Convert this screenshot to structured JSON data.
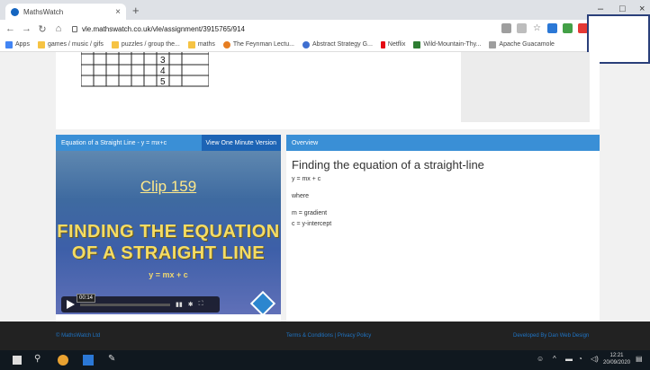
{
  "browser": {
    "tab_title": "MathsWatch",
    "tab_close": "×",
    "new_tab": "+",
    "url": "vle.mathswatch.co.uk/vle/assignment/3915765/914",
    "bookmarks": [
      "Apps",
      "games / music / gifs",
      "puzzles / group the...",
      "maths",
      "The Feynman Lectu...",
      "Abstract Strategy G...",
      "Netflix",
      "Wild-Mountain-Thy...",
      "Apache Guacamole"
    ],
    "window_controls": [
      "–",
      "□",
      "×"
    ]
  },
  "figure": {
    "labels": [
      "3",
      "4",
      "5"
    ]
  },
  "video_panel": {
    "header": "Equation of a Straight Line - y = mx+c",
    "button": "View One Minute Version",
    "clip": "Clip 159",
    "title_line1": "FINDING THE EQUATION",
    "title_line2": "OF A STRAIGHT LINE",
    "formula": "y = mx + c",
    "timestamp": "00:14",
    "progress": 0.02
  },
  "overview": {
    "header": "Overview",
    "title": "Finding the equation of a straight-line",
    "line1": "y = mx + c",
    "line2": "where",
    "line3": "m = gradient",
    "line4": "c = y-intercept"
  },
  "footer": {
    "left": "© MathsWatch Ltd",
    "center": "Terms & Conditions | Privacy Policy",
    "right": "Developed By Dan Web Design"
  },
  "taskbar": {
    "time": "12:21",
    "date": "20/09/2020"
  }
}
